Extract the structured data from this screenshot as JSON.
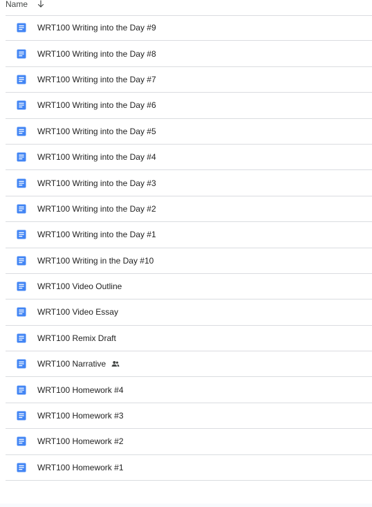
{
  "header": {
    "label": "Name",
    "sort_icon": "arrow-down-icon"
  },
  "files": [
    {
      "name": "WRT100 Writing into the Day #9",
      "icon": "google-docs-icon",
      "shared": false
    },
    {
      "name": "WRT100 Writing into the Day #8",
      "icon": "google-docs-icon",
      "shared": false
    },
    {
      "name": "WRT100 Writing into the Day #7",
      "icon": "google-docs-icon",
      "shared": false
    },
    {
      "name": "WRT100 Writing into the Day #6",
      "icon": "google-docs-icon",
      "shared": false
    },
    {
      "name": "WRT100 Writing into the Day #5",
      "icon": "google-docs-icon",
      "shared": false
    },
    {
      "name": "WRT100 Writing into the Day #4",
      "icon": "google-docs-icon",
      "shared": false
    },
    {
      "name": "WRT100 Writing into the Day #3",
      "icon": "google-docs-icon",
      "shared": false
    },
    {
      "name": "WRT100 Writing into the Day #2",
      "icon": "google-docs-icon",
      "shared": false
    },
    {
      "name": "WRT100 Writing into the Day #1",
      "icon": "google-docs-icon",
      "shared": false
    },
    {
      "name": "WRT100 Writing in the Day #10",
      "icon": "google-docs-icon",
      "shared": false
    },
    {
      "name": "WRT100 Video Outline",
      "icon": "google-docs-icon",
      "shared": false
    },
    {
      "name": "WRT100 Video Essay",
      "icon": "google-docs-icon",
      "shared": false
    },
    {
      "name": "WRT100 Remix Draft",
      "icon": "google-docs-icon",
      "shared": false
    },
    {
      "name": "WRT100 Narrative",
      "icon": "google-docs-icon",
      "shared": true
    },
    {
      "name": "WRT100 Homework #4",
      "icon": "google-docs-icon",
      "shared": false
    },
    {
      "name": "WRT100 Homework #3",
      "icon": "google-docs-icon",
      "shared": false
    },
    {
      "name": "WRT100 Homework #2",
      "icon": "google-docs-icon",
      "shared": false
    },
    {
      "name": "WRT100 Homework #1",
      "icon": "google-docs-icon",
      "shared": false
    }
  ],
  "colors": {
    "doc_icon": "#4285f4",
    "divider": "#dadce0",
    "text": "#1f1f1f"
  }
}
